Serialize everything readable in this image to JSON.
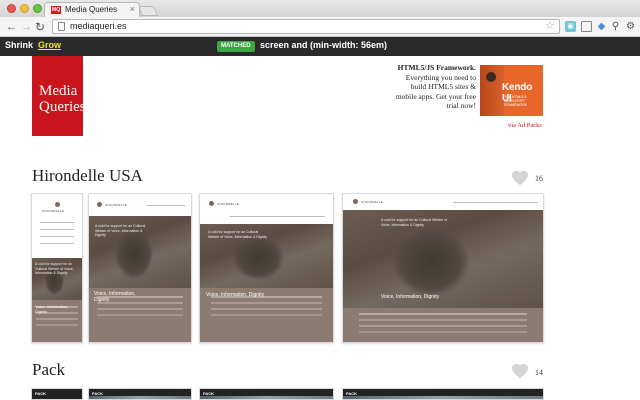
{
  "browser": {
    "tab_title": "Media Queries",
    "tab_favicon_text": "MQ",
    "tab_close": "×",
    "url": "mediaqueri.es",
    "nav": {
      "back": "←",
      "forward": "→",
      "reload": "↻"
    },
    "star": "☆",
    "extensions": [
      "puzzle-ext",
      "page-ext",
      "drop-ext",
      "wrench-ext",
      "gear-ext"
    ]
  },
  "query_bar": {
    "shrink": "Shrink",
    "grow": "Grow",
    "badge": "MATCHED",
    "query": "screen and (min-width: 56em)",
    "colors": {
      "bar": "#2a2a2a",
      "grow": "#f0e442",
      "badge": "#3aa843"
    }
  },
  "logo": {
    "line1": "Media",
    "line2": "Queries",
    "color": "#c9141b"
  },
  "ad": {
    "headline": "HTML5/JS Framework.",
    "body": "Everything you need to build HTML5 sites & mobile apps. Get your free trial now!",
    "brand": "Kendo UI",
    "brand_sub": "THE HTML5 & JAVASCRIPT FRAMEWORK",
    "via": "via Ad Packs"
  },
  "sections": [
    {
      "title": "Hirondelle USA",
      "likes": "16",
      "thumb_brand": "HIRONDELLE",
      "hero_text": "A cold for support for an Cultural Wefare of Voice, Information & Dignity",
      "voice_text": "Voice, Information, Dignity"
    },
    {
      "title": "Pack",
      "likes": "14",
      "thumb_brand": "PACK"
    }
  ]
}
